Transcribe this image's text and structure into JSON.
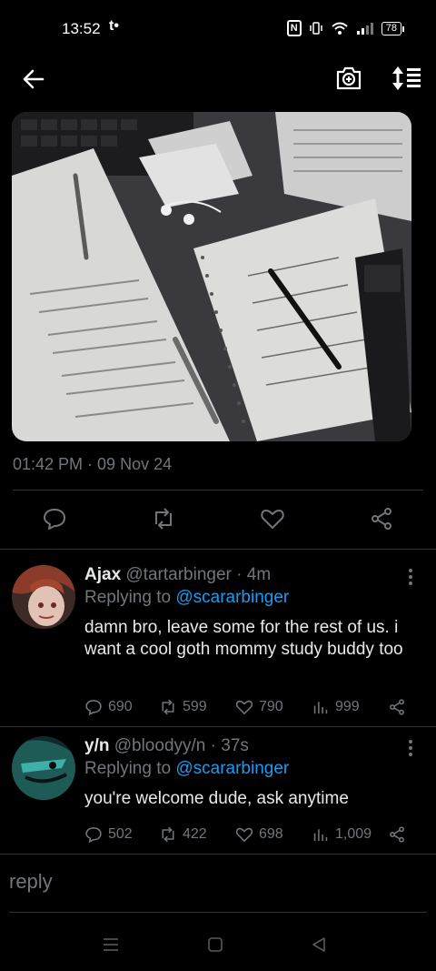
{
  "status_bar": {
    "time": "13:52",
    "notif": "t•",
    "nfc": "N",
    "battery": "78"
  },
  "toolbar": {
    "back_icon": "arrow-left-icon",
    "camera_icon": "camera-plus-icon",
    "sort_icon": "sort-icon"
  },
  "post": {
    "timestamp": "01:42 PM · 09 Nov 24"
  },
  "replies": [
    {
      "name": "Ajax",
      "handle": "@tartarbinger",
      "age": "· 4m",
      "replying_prefix": "Replying to",
      "replying_to": "@scararbinger",
      "text": "damn bro, leave some for the rest of us. i want a cool goth mommy study buddy too",
      "comments": "690",
      "reposts": "599",
      "likes": "790",
      "views": "999"
    },
    {
      "name": "y/n",
      "handle": "@bloodyy/n",
      "age": "· 37s",
      "replying_prefix": "Replying to",
      "replying_to": "@scararbinger",
      "text": "you're welcome dude, ask anytime",
      "comments": "502",
      "reposts": "422",
      "likes": "698",
      "views": "1,009"
    }
  ],
  "composer": {
    "placeholder": "reply"
  },
  "colors": {
    "background": "#000000",
    "text": "#e7e9ea",
    "muted": "#71767b",
    "link": "#1d9bf0",
    "divider": "#2f3336"
  }
}
